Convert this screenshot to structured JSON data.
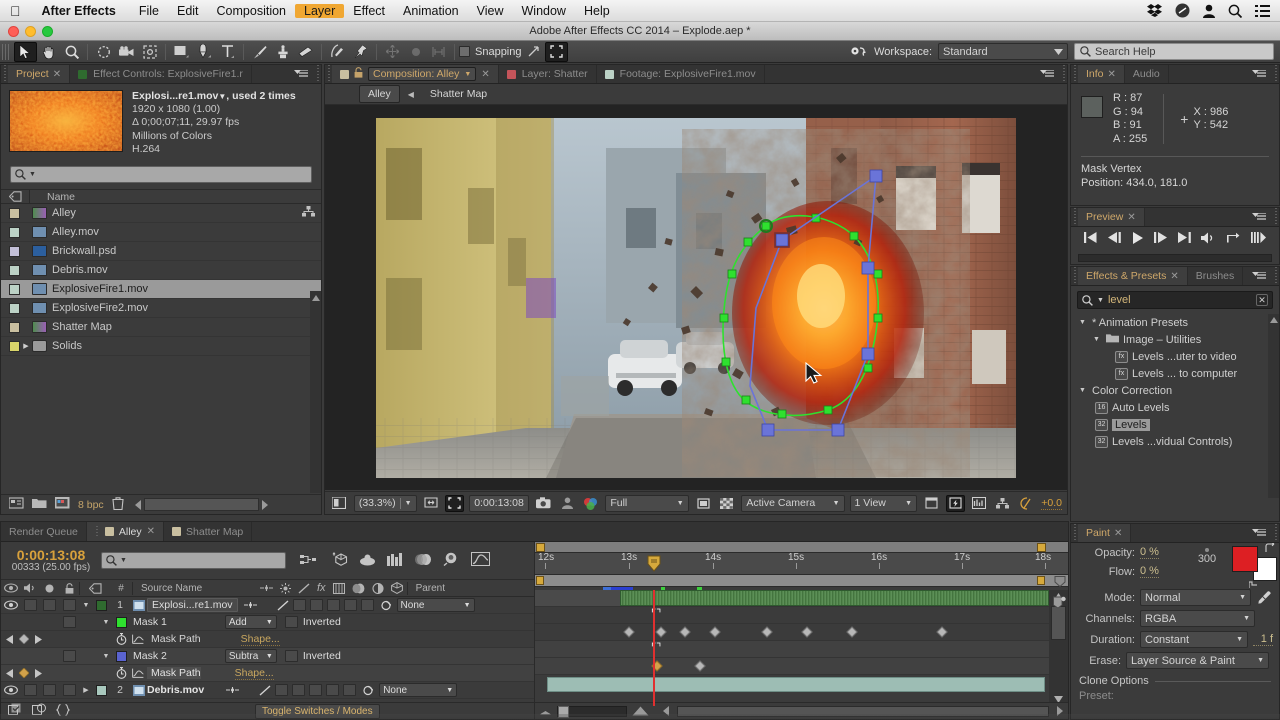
{
  "mac_menu": {
    "apple": "apple-logo",
    "items": [
      {
        "label": "After Effects",
        "bold": true
      },
      {
        "label": "File"
      },
      {
        "label": "Edit"
      },
      {
        "label": "Composition"
      },
      {
        "label": "Layer",
        "highlighted": true
      },
      {
        "label": "Effect"
      },
      {
        "label": "Animation"
      },
      {
        "label": "View"
      },
      {
        "label": "Window"
      },
      {
        "label": "Help"
      }
    ],
    "status_icons": [
      "dropbox-icon",
      "app-icon",
      "user-icon",
      "search-icon",
      "list-icon"
    ]
  },
  "title_bar": {
    "title": "Adobe After Effects CC 2014 – Explode.aep *"
  },
  "toolbar": {
    "tools": [
      {
        "name": "selection-tool",
        "selected": true
      },
      {
        "name": "hand-tool"
      },
      {
        "name": "zoom-tool"
      },
      {
        "name": "rotation-tool"
      },
      {
        "name": "camera-tool"
      },
      {
        "name": "pan-behind-tool"
      },
      {
        "name": "shape-tool"
      },
      {
        "name": "pen-tool"
      },
      {
        "name": "type-tool"
      },
      {
        "name": "brush-tool"
      },
      {
        "name": "clone-stamp-tool"
      },
      {
        "name": "eraser-tool"
      },
      {
        "name": "roto-brush-tool"
      },
      {
        "name": "puppet-pin-tool"
      }
    ],
    "snapping_label": "Snapping",
    "workspace_label": "Workspace:",
    "workspace_value": "Standard",
    "search_help_placeholder": "Search Help"
  },
  "project_panel": {
    "tabs": [
      {
        "label": "Project",
        "active": true,
        "closable": true
      },
      {
        "label": "Effect Controls: ExplosiveFire1.r",
        "active": false
      }
    ],
    "preview": {
      "title": "Explosi...re1.mov",
      "used": ", used 2 times",
      "dimensions": "1920 x 1080 (1.00)",
      "duration": "Δ 0;00;07;11, 29.97 fps",
      "colors": "Millions of Colors",
      "codec": "H.264"
    },
    "search_placeholder": "",
    "column_header": "Name",
    "items": [
      {
        "name": "Alley",
        "type": "composition",
        "swatch": "#c9bfa0"
      },
      {
        "name": "Alley.mov",
        "type": "movie",
        "swatch": "#bcd2c6"
      },
      {
        "name": "Brickwall.psd",
        "type": "psd",
        "swatch": "#c3c0d8"
      },
      {
        "name": "Debris.mov",
        "type": "movie",
        "swatch": "#bcd2c6"
      },
      {
        "name": "ExplosiveFire1.mov",
        "type": "movie",
        "swatch": "#bcd2c6",
        "selected": true
      },
      {
        "name": "ExplosiveFire2.mov",
        "type": "movie",
        "swatch": "#bcd2c6"
      },
      {
        "name": "Shatter Map",
        "type": "composition",
        "swatch": "#c9bfa0"
      },
      {
        "name": "Solids",
        "type": "folder",
        "swatch": "#d9d56a",
        "expandable": true
      }
    ],
    "footer": {
      "bpc": "8 bpc"
    }
  },
  "comp_panel": {
    "tabs": [
      {
        "label": "Composition: Alley",
        "active": true,
        "swatch": "#c9bfa0"
      },
      {
        "label": "Layer: Shatter",
        "active": false,
        "swatch": "#c4545a"
      },
      {
        "label": "Footage: ExplosiveFire1.mov",
        "active": false,
        "swatch": "#bcd2c6"
      }
    ],
    "breadcrumb": [
      {
        "label": "Alley",
        "boxed": true
      },
      {
        "label": "Shatter Map",
        "boxed": false
      }
    ],
    "footer": {
      "zoom": "(33.3%)",
      "timecode": "0:00:13:08",
      "resolution": "Full",
      "camera": "Active Camera",
      "views": "1 View",
      "exposure": "+0.0"
    }
  },
  "info_panel": {
    "tabs": [
      {
        "label": "Info",
        "active": true
      },
      {
        "label": "Audio",
        "active": false
      }
    ],
    "R": "R : 87",
    "G": "G : 94",
    "B": "B : 91",
    "A": "A : 255",
    "X": "X : 986",
    "Y": "Y : 542",
    "sample_color": "#575e5b",
    "mask_title": "Mask Vertex",
    "mask_position": "Position: 434.0, 181.0"
  },
  "preview_panel": {
    "tabs": [
      {
        "label": "Preview",
        "active": true
      }
    ],
    "buttons": [
      "first-frame-button",
      "previous-frame-button",
      "play-button",
      "next-frame-button",
      "last-frame-button",
      "mute-button",
      "loop-button",
      "ram-preview-button"
    ]
  },
  "effects_panel": {
    "tabs": [
      {
        "label": "Effects & Presets",
        "active": true
      },
      {
        "label": "Brushes",
        "active": false
      }
    ],
    "search_value": "level",
    "rows": [
      {
        "label": "* Animation Presets",
        "indent": 0,
        "tri": "down",
        "icon": "none"
      },
      {
        "label": "Image – Utilities",
        "indent": 1,
        "tri": "down",
        "icon": "folder"
      },
      {
        "label": "Levels ...uter to video",
        "indent": 2,
        "tri": "none",
        "icon": "preset"
      },
      {
        "label": "Levels ... to computer",
        "indent": 2,
        "tri": "none",
        "icon": "preset"
      },
      {
        "label": "Color Correction",
        "indent": 0,
        "tri": "down",
        "icon": "none"
      },
      {
        "label": "Auto Levels",
        "indent": 1,
        "tri": "none",
        "icon": "fx16"
      },
      {
        "label": "Levels",
        "indent": 1,
        "tri": "none",
        "icon": "fx32",
        "selected": true
      },
      {
        "label": "Levels ...vidual Controls)",
        "indent": 1,
        "tri": "none",
        "icon": "fx32"
      }
    ]
  },
  "paint_panel": {
    "tabs": [
      {
        "label": "Paint",
        "active": true
      }
    ],
    "opacity_label": "Opacity:",
    "opacity_value": "0 %",
    "flow_label": "Flow:",
    "flow_value": "0 %",
    "brush_size": "300",
    "mode_label": "Mode:",
    "mode_value": "Normal",
    "channels_label": "Channels:",
    "channels_value": "RGBA",
    "duration_label": "Duration:",
    "duration_value": "Constant",
    "duration_frames": "1 f",
    "erase_label": "Erase:",
    "erase_value": "Layer Source & Paint",
    "clone_options": "Clone Options",
    "foreground_color": "#dd1f23",
    "background_color": "#ffffff"
  },
  "timeline": {
    "tabs": [
      {
        "label": "Render Queue",
        "active": false
      },
      {
        "label": "Alley",
        "active": true,
        "closable": true,
        "swatch": "#c9bfa0"
      },
      {
        "label": "Shatter Map",
        "active": false,
        "swatch": "#c9bfa0"
      }
    ],
    "current_time": "0:00:13:08",
    "frame_info": "00333 (25.00 fps)",
    "search_placeholder": "",
    "columns": [
      "#",
      "Source Name",
      "Parent"
    ],
    "toggle_switches_label": "Toggle Switches / Modes",
    "rows": [
      {
        "kind": "layer",
        "index": "1",
        "name": "Explosi...re1.mov",
        "parent": "None",
        "swatch": "#2f6b2f",
        "editing": true,
        "expanded": true
      },
      {
        "kind": "mask",
        "name": "Mask 1",
        "mode": "Add",
        "inverted": "Inverted",
        "swatch": "#2fe02f",
        "expanded": true
      },
      {
        "kind": "prop",
        "name": "Mask Path",
        "value": "Shape..."
      },
      {
        "kind": "mask",
        "name": "Mask 2",
        "mode": "Subtra",
        "inverted": "Inverted",
        "swatch": "#5a63cf",
        "expanded": true,
        "selected": true
      },
      {
        "kind": "prop",
        "name": "Mask Path",
        "value": "Shape...",
        "selected": true
      },
      {
        "kind": "layer",
        "index": "2",
        "name": "Debris.mov",
        "parent": "None",
        "swatch": "#a8c8bd",
        "expanded": false
      }
    ],
    "ruler": {
      "labels": [
        "12s",
        "13s",
        "14s",
        "15s",
        "16s",
        "17s",
        "18s"
      ],
      "start": 12,
      "end": 18.2
    },
    "keyframes_mask1": [
      12.75,
      13.3,
      13.5,
      13.8,
      14.35,
      14.75,
      15.2,
      16.1
    ],
    "keyframes_mask2": [
      13.3,
      13.75
    ],
    "playhead_time": 13.32
  }
}
